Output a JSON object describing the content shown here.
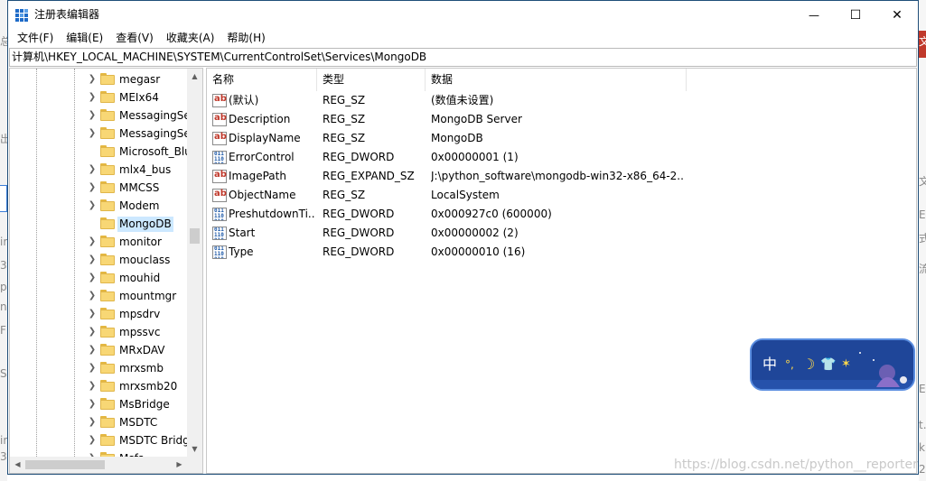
{
  "window": {
    "title": "注册表编辑器",
    "controls": {
      "minimize": "—",
      "maximize": "☐",
      "close": "✕"
    }
  },
  "menu": [
    "文件(F)",
    "编辑(E)",
    "查看(V)",
    "收藏夹(A)",
    "帮助(H)"
  ],
  "address": "计算机\\HKEY_LOCAL_MACHINE\\SYSTEM\\CurrentControlSet\\Services\\MongoDB",
  "tree": {
    "items": [
      {
        "label": "megasr",
        "expandable": true
      },
      {
        "label": "MEIx64",
        "expandable": true
      },
      {
        "label": "MessagingSe",
        "expandable": true
      },
      {
        "label": "MessagingSe",
        "expandable": true
      },
      {
        "label": "Microsoft_Blu",
        "expandable": false
      },
      {
        "label": "mlx4_bus",
        "expandable": true
      },
      {
        "label": "MMCSS",
        "expandable": true
      },
      {
        "label": "Modem",
        "expandable": true
      },
      {
        "label": "MongoDB",
        "expandable": false,
        "selected": true
      },
      {
        "label": "monitor",
        "expandable": true
      },
      {
        "label": "mouclass",
        "expandable": true
      },
      {
        "label": "mouhid",
        "expandable": true
      },
      {
        "label": "mountmgr",
        "expandable": true
      },
      {
        "label": "mpsdrv",
        "expandable": true
      },
      {
        "label": "mpssvc",
        "expandable": true
      },
      {
        "label": "MRxDAV",
        "expandable": true
      },
      {
        "label": "mrxsmb",
        "expandable": true
      },
      {
        "label": "mrxsmb20",
        "expandable": true
      },
      {
        "label": "MsBridge",
        "expandable": true
      },
      {
        "label": "MSDTC",
        "expandable": true
      },
      {
        "label": "MSDTC Bridg",
        "expandable": true
      },
      {
        "label": "Msfs",
        "expandable": true
      }
    ]
  },
  "values": {
    "headers": {
      "name": "名称",
      "type": "类型",
      "data": "数据"
    },
    "rows": [
      {
        "icon": "string-value-icon",
        "name": "(默认)",
        "type": "REG_SZ",
        "data": "(数值未设置)"
      },
      {
        "icon": "string-value-icon",
        "name": "Description",
        "type": "REG_SZ",
        "data": "MongoDB Server"
      },
      {
        "icon": "string-value-icon",
        "name": "DisplayName",
        "type": "REG_SZ",
        "data": "MongoDB"
      },
      {
        "icon": "binary-value-icon",
        "name": "ErrorControl",
        "type": "REG_DWORD",
        "data": "0x00000001 (1)"
      },
      {
        "icon": "string-value-icon",
        "name": "ImagePath",
        "type": "REG_EXPAND_SZ",
        "data": "J:\\python_software\\mongodb-win32-x86_64-2..."
      },
      {
        "icon": "string-value-icon",
        "name": "ObjectName",
        "type": "REG_SZ",
        "data": "LocalSystem"
      },
      {
        "icon": "binary-value-icon",
        "name": "PreshutdownTi...",
        "type": "REG_DWORD",
        "data": "0x000927c0 (600000)"
      },
      {
        "icon": "binary-value-icon",
        "name": "Start",
        "type": "REG_DWORD",
        "data": "0x00000002 (2)"
      },
      {
        "icon": "binary-value-icon",
        "name": "Type",
        "type": "REG_DWORD",
        "data": "0x00000010 (16)"
      }
    ]
  },
  "ime": {
    "mode": "中",
    "glyphs": [
      "°,",
      "☽",
      "👕",
      "✶"
    ]
  },
  "watermark": "https://blog.csdn.net/python__reporter",
  "background_fragments": {
    "left": [
      "总",
      "出",
      "ir",
      "3",
      "pe",
      "n",
      "F",
      "S",
      "ir",
      "3"
    ],
    "right": [
      "文",
      "文",
      "E",
      "式",
      "流",
      "E",
      "t.",
      "k",
      "2"
    ]
  },
  "colors": {
    "title_icon": "#1e6bc8",
    "selection": "#cce8ff",
    "folder": "#f8d775",
    "ime_bg": "#1f4699",
    "ime_border": "#5b8ee0"
  }
}
